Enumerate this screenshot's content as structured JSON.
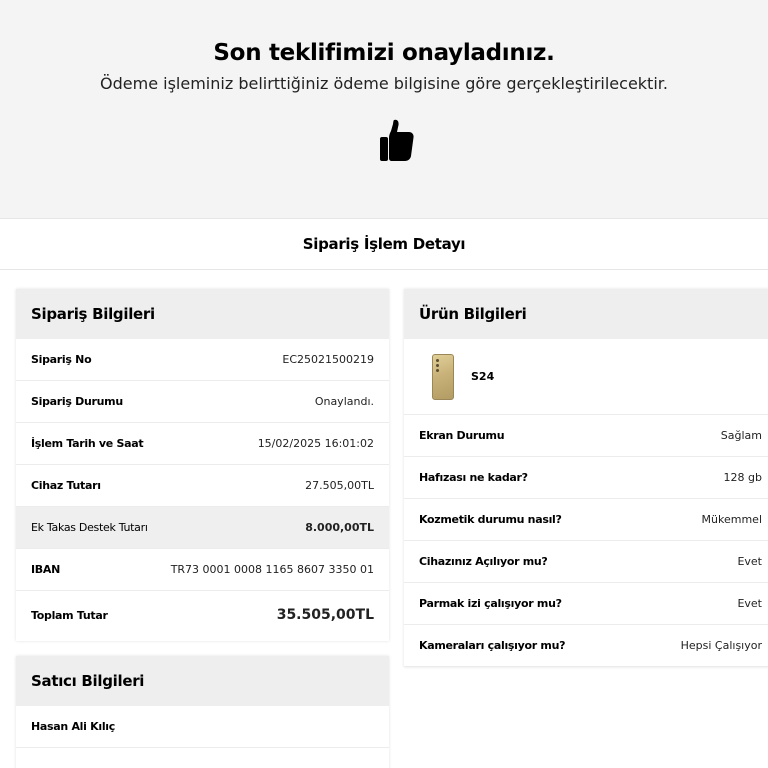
{
  "hero": {
    "title": "Son teklifimizi onayladınız.",
    "subtitle": "Ödeme işleminiz belirttiğiniz ödeme bilgisine göre gerçekleştirilecektir.",
    "icon": "thumbs-up-icon"
  },
  "detail": {
    "title": "Sipariş İşlem Detayı"
  },
  "order": {
    "title": "Sipariş Bilgileri",
    "rows": [
      {
        "label": "Sipariş No",
        "value": "EC25021500219"
      },
      {
        "label": "Sipariş Durumu",
        "value": "Onaylandı."
      },
      {
        "label": "İşlem Tarih ve Saat",
        "value": "15/02/2025 16:01:02"
      },
      {
        "label": "Cihaz Tutarı",
        "value": "27.505,00TL"
      },
      {
        "label": "Ek Takas Destek Tutarı",
        "value": "8.000,00TL"
      },
      {
        "label": "IBAN",
        "value": "TR73 0001 0008 1165 8607 3350 01"
      },
      {
        "label": "Toplam Tutar",
        "value": "35.505,00TL"
      }
    ]
  },
  "seller": {
    "title": "Satıcı Bilgileri",
    "name": "Hasan Ali Kılıç"
  },
  "product": {
    "title": "Ürün Bilgileri",
    "name": "S24",
    "rows": [
      {
        "label": "Ekran Durumu",
        "value": "Sağlam"
      },
      {
        "label": "Hafızası ne kadar?",
        "value": "128 gb"
      },
      {
        "label": "Kozmetik durumu nasıl?",
        "value": "Mükemmel"
      },
      {
        "label": "Cihazınız Açılıyor mu?",
        "value": "Evet"
      },
      {
        "label": "Parmak izi çalışıyor mu?",
        "value": "Evet"
      },
      {
        "label": "Kameraları çalışıyor mu?",
        "value": "Hepsi Çalışıyor"
      }
    ]
  }
}
